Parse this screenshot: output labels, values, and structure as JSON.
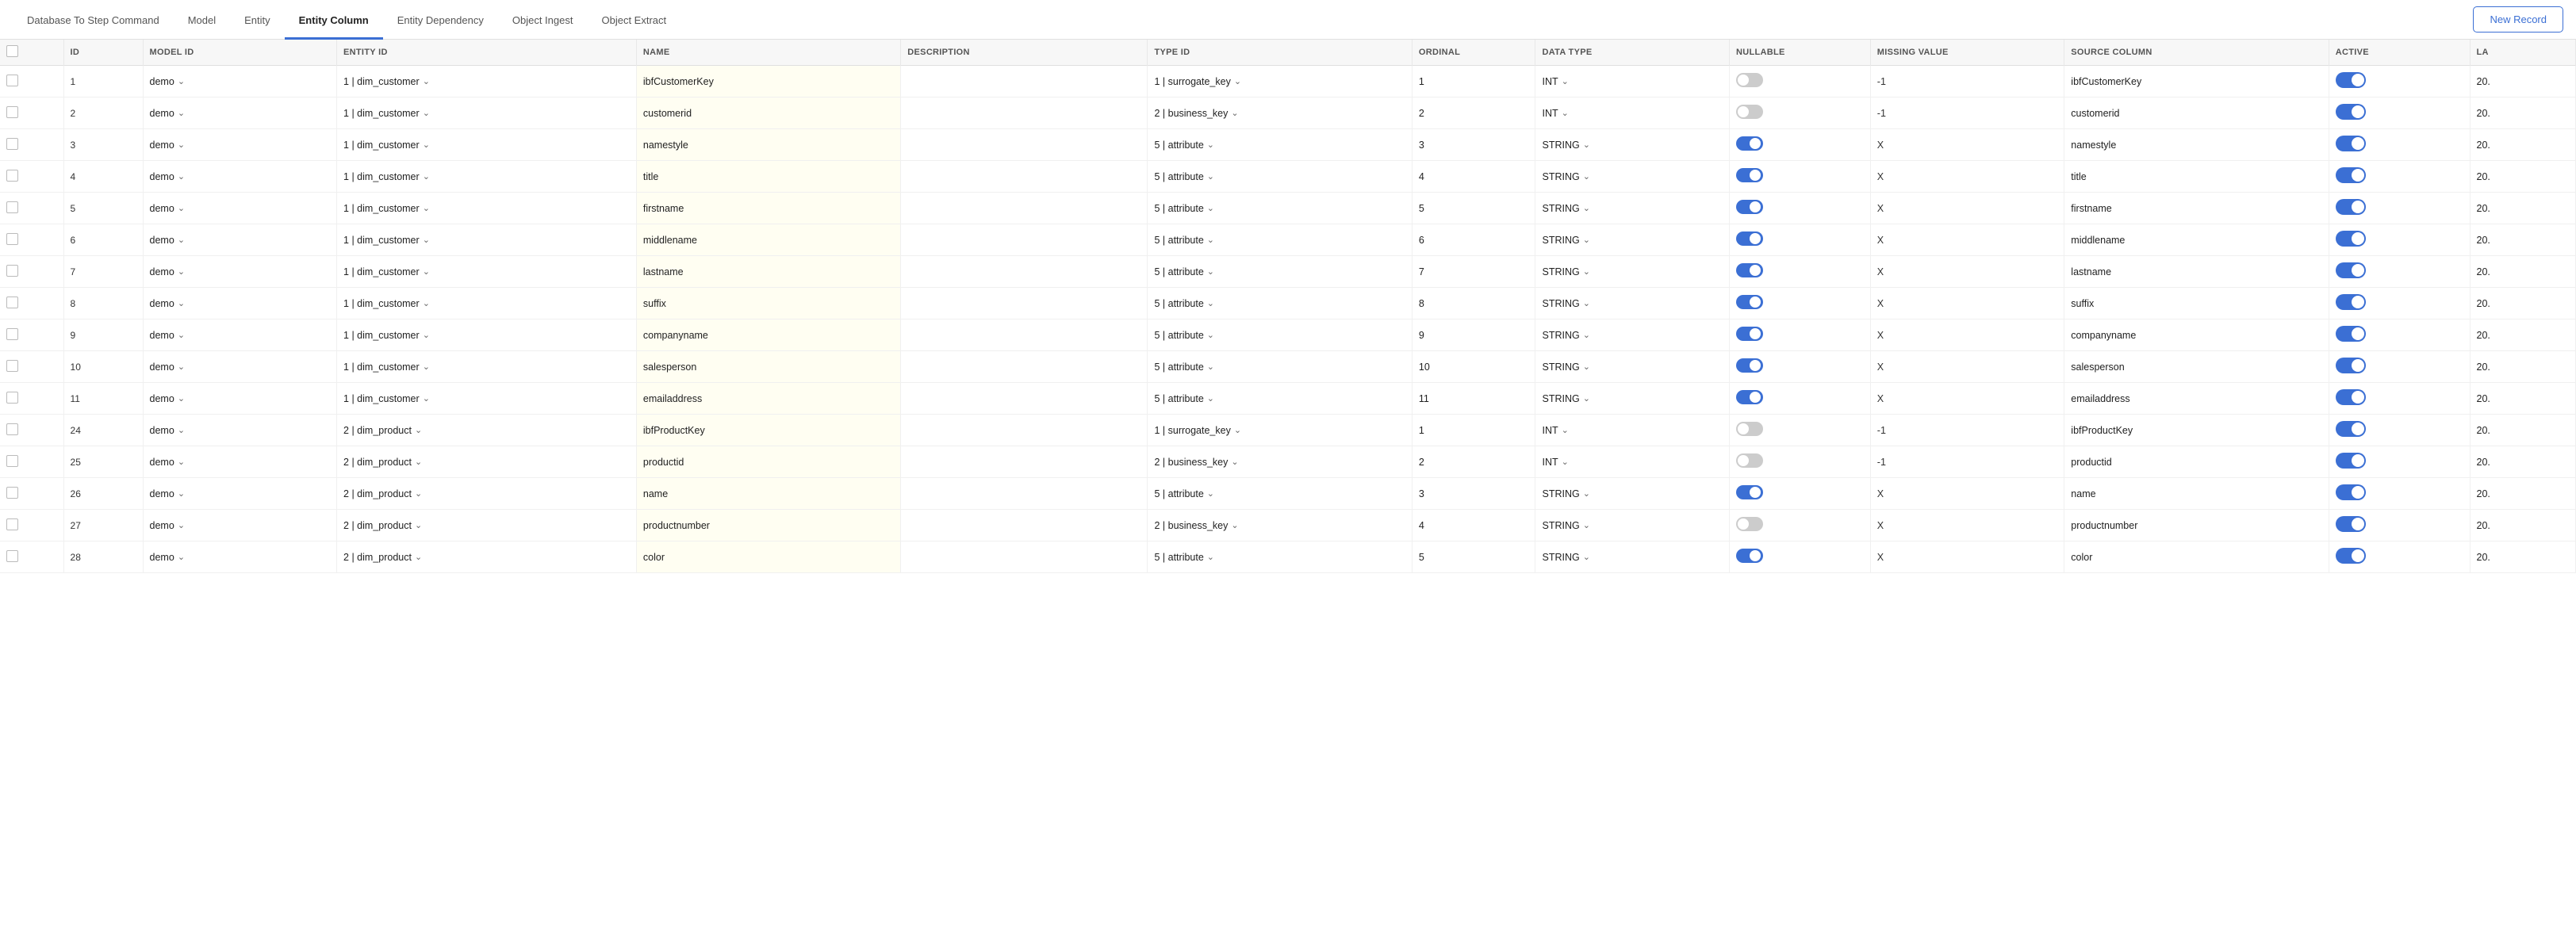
{
  "tabs": [
    {
      "id": "db-step",
      "label": "Database To Step Command",
      "active": false
    },
    {
      "id": "model",
      "label": "Model",
      "active": false
    },
    {
      "id": "entity",
      "label": "Entity",
      "active": false
    },
    {
      "id": "entity-column",
      "label": "Entity Column",
      "active": true
    },
    {
      "id": "entity-dependency",
      "label": "Entity Dependency",
      "active": false
    },
    {
      "id": "object-ingest",
      "label": "Object Ingest",
      "active": false
    },
    {
      "id": "object-extract",
      "label": "Object Extract",
      "active": false
    }
  ],
  "newRecordLabel": "New Record",
  "columns": [
    {
      "key": "checkbox",
      "label": ""
    },
    {
      "key": "id",
      "label": "ID"
    },
    {
      "key": "model_id",
      "label": "MODEL ID"
    },
    {
      "key": "entity_id",
      "label": "ENTITY ID"
    },
    {
      "key": "name",
      "label": "NAME"
    },
    {
      "key": "description",
      "label": "DESCRIPTION"
    },
    {
      "key": "type_id",
      "label": "TYPE ID"
    },
    {
      "key": "ordinal",
      "label": "ORDINAL"
    },
    {
      "key": "data_type",
      "label": "DATA TYPE"
    },
    {
      "key": "nullable",
      "label": "NULLABLE"
    },
    {
      "key": "missing_value",
      "label": "MISSING VALUE"
    },
    {
      "key": "source_column",
      "label": "SOURCE COLUMN"
    },
    {
      "key": "active",
      "label": "ACTIVE"
    },
    {
      "key": "la",
      "label": "LA"
    }
  ],
  "rows": [
    {
      "id": 1,
      "model_id": "demo",
      "entity_id": "1 | dim_customer",
      "name": "ibfCustomerKey",
      "description": "",
      "type_id": "1 | surrogate_key",
      "ordinal": 1,
      "data_type": "INT",
      "nullable_on": false,
      "missing_value": "-1",
      "source_column": "ibfCustomerKey",
      "active_on": true,
      "la": "20."
    },
    {
      "id": 2,
      "model_id": "demo",
      "entity_id": "1 | dim_customer",
      "name": "customerid",
      "description": "",
      "type_id": "2 | business_key",
      "ordinal": 2,
      "data_type": "INT",
      "nullable_on": false,
      "missing_value": "-1",
      "source_column": "customerid",
      "active_on": true,
      "la": "20."
    },
    {
      "id": 3,
      "model_id": "demo",
      "entity_id": "1 | dim_customer",
      "name": "namestyle",
      "description": "",
      "type_id": "5 | attribute",
      "ordinal": 3,
      "data_type": "STRING",
      "nullable_on": true,
      "missing_value": "X",
      "source_column": "namestyle",
      "active_on": true,
      "la": "20."
    },
    {
      "id": 4,
      "model_id": "demo",
      "entity_id": "1 | dim_customer",
      "name": "title",
      "description": "",
      "type_id": "5 | attribute",
      "ordinal": 4,
      "data_type": "STRING",
      "nullable_on": true,
      "missing_value": "X",
      "source_column": "title",
      "active_on": true,
      "la": "20."
    },
    {
      "id": 5,
      "model_id": "demo",
      "entity_id": "1 | dim_customer",
      "name": "firstname",
      "description": "",
      "type_id": "5 | attribute",
      "ordinal": 5,
      "data_type": "STRING",
      "nullable_on": true,
      "missing_value": "X",
      "source_column": "firstname",
      "active_on": true,
      "la": "20."
    },
    {
      "id": 6,
      "model_id": "demo",
      "entity_id": "1 | dim_customer",
      "name": "middlename",
      "description": "",
      "type_id": "5 | attribute",
      "ordinal": 6,
      "data_type": "STRING",
      "nullable_on": true,
      "missing_value": "X",
      "source_column": "middlename",
      "active_on": true,
      "la": "20."
    },
    {
      "id": 7,
      "model_id": "demo",
      "entity_id": "1 | dim_customer",
      "name": "lastname",
      "description": "",
      "type_id": "5 | attribute",
      "ordinal": 7,
      "data_type": "STRING",
      "nullable_on": true,
      "missing_value": "X",
      "source_column": "lastname",
      "active_on": true,
      "la": "20."
    },
    {
      "id": 8,
      "model_id": "demo",
      "entity_id": "1 | dim_customer",
      "name": "suffix",
      "description": "",
      "type_id": "5 | attribute",
      "ordinal": 8,
      "data_type": "STRING",
      "nullable_on": true,
      "missing_value": "X",
      "source_column": "suffix",
      "active_on": true,
      "la": "20."
    },
    {
      "id": 9,
      "model_id": "demo",
      "entity_id": "1 | dim_customer",
      "name": "companyname",
      "description": "",
      "type_id": "5 | attribute",
      "ordinal": 9,
      "data_type": "STRING",
      "nullable_on": true,
      "missing_value": "X",
      "source_column": "companyname",
      "active_on": true,
      "la": "20."
    },
    {
      "id": 10,
      "model_id": "demo",
      "entity_id": "1 | dim_customer",
      "name": "salesperson",
      "description": "",
      "type_id": "5 | attribute",
      "ordinal": 10,
      "data_type": "STRING",
      "nullable_on": true,
      "missing_value": "X",
      "source_column": "salesperson",
      "active_on": true,
      "la": "20."
    },
    {
      "id": 11,
      "model_id": "demo",
      "entity_id": "1 | dim_customer",
      "name": "emailaddress",
      "description": "",
      "type_id": "5 | attribute",
      "ordinal": 11,
      "data_type": "STRING",
      "nullable_on": true,
      "missing_value": "X",
      "source_column": "emailaddress",
      "active_on": true,
      "la": "20."
    },
    {
      "id": 24,
      "model_id": "demo",
      "entity_id": "2 | dim_product",
      "name": "ibfProductKey",
      "description": "",
      "type_id": "1 | surrogate_key",
      "ordinal": 1,
      "data_type": "INT",
      "nullable_on": false,
      "missing_value": "-1",
      "source_column": "ibfProductKey",
      "active_on": true,
      "la": "20."
    },
    {
      "id": 25,
      "model_id": "demo",
      "entity_id": "2 | dim_product",
      "name": "productid",
      "description": "",
      "type_id": "2 | business_key",
      "ordinal": 2,
      "data_type": "INT",
      "nullable_on": false,
      "missing_value": "-1",
      "source_column": "productid",
      "active_on": true,
      "la": "20."
    },
    {
      "id": 26,
      "model_id": "demo",
      "entity_id": "2 | dim_product",
      "name": "name",
      "description": "",
      "type_id": "5 | attribute",
      "ordinal": 3,
      "data_type": "STRING",
      "nullable_on": true,
      "missing_value": "X",
      "source_column": "name",
      "active_on": true,
      "la": "20."
    },
    {
      "id": 27,
      "model_id": "demo",
      "entity_id": "2 | dim_product",
      "name": "productnumber",
      "description": "",
      "type_id": "2 | business_key",
      "ordinal": 4,
      "data_type": "STRING",
      "nullable_on": false,
      "missing_value": "X",
      "source_column": "productnumber",
      "active_on": true,
      "la": "20."
    },
    {
      "id": 28,
      "model_id": "demo",
      "entity_id": "2 | dim_product",
      "name": "color",
      "description": "",
      "type_id": "5 | attribute",
      "ordinal": 5,
      "data_type": "STRING",
      "nullable_on": true,
      "missing_value": "X",
      "source_column": "color",
      "active_on": true,
      "la": "20."
    }
  ]
}
